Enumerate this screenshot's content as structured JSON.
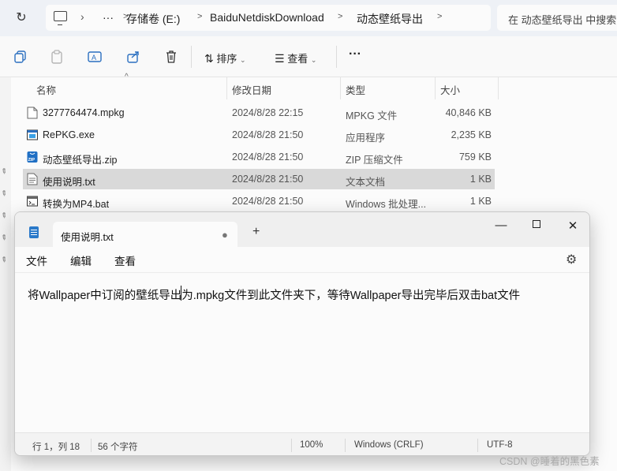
{
  "explorer": {
    "breadcrumb": [
      "存储卷 (E:)",
      "BaiduNetdiskDownload",
      "动态壁纸导出"
    ],
    "overflow": "···",
    "search_placeholder": "在 动态壁纸导出 中搜索",
    "toolbar": {
      "sort_label": "排序",
      "view_label": "查看",
      "more": "···"
    },
    "columns": {
      "name": "名称",
      "modified": "修改日期",
      "type": "类型",
      "size": "大小"
    },
    "files": [
      {
        "name": "3277764474.mpkg",
        "modified": "2024/8/28 22:15",
        "type": "MPKG 文件",
        "size": "40,846 KB",
        "icon": "file-icon"
      },
      {
        "name": "RePKG.exe",
        "modified": "2024/8/28 21:50",
        "type": "应用程序",
        "size": "2,235 KB",
        "icon": "exe-icon"
      },
      {
        "name": "动态壁纸导出.zip",
        "modified": "2024/8/28 21:50",
        "type": "ZIP 压缩文件",
        "size": "759 KB",
        "icon": "zip-icon"
      },
      {
        "name": "使用说明.txt",
        "modified": "2024/8/28 21:50",
        "type": "文本文档",
        "size": "1 KB",
        "icon": "txt-icon",
        "selected": true
      },
      {
        "name": "转换为MP4.bat",
        "modified": "2024/8/28 21:50",
        "type": "Windows 批处理...",
        "size": "1 KB",
        "icon": "bat-icon"
      }
    ]
  },
  "notepad": {
    "tab_title": "使用说明.txt",
    "menu": {
      "file": "文件",
      "edit": "编辑",
      "view": "查看"
    },
    "content": "将Wallpaper中订阅的壁纸导出为.mpkg文件到此文件夹下，等待Wallpaper导出完毕后双击bat文件",
    "status": {
      "position": "行 1，列 18",
      "chars": "56 个字符",
      "zoom": "100%",
      "line_ending": "Windows (CRLF)",
      "encoding": "UTF-8"
    }
  },
  "watermark": "CSDN @睡着的黑色素"
}
